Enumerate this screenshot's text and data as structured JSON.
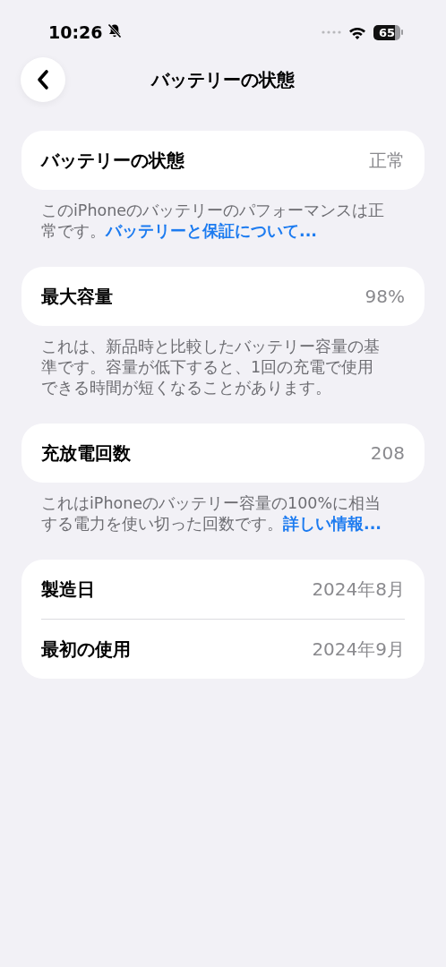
{
  "status_bar": {
    "time": "10:26",
    "silent": true,
    "battery": "65"
  },
  "nav": {
    "title": "バッテリーの状態"
  },
  "groups": [
    {
      "rows": [
        {
          "label": "バッテリーの状態",
          "value": "正常"
        }
      ],
      "footer": {
        "text": "このiPhoneのバッテリーのパフォーマンスは正常です。",
        "link": "バッテリーと保証について..."
      }
    },
    {
      "rows": [
        {
          "label": "最大容量",
          "value": "98%"
        }
      ],
      "footer": {
        "text": "これは、新品時と比較したバッテリー容量の基準です。容量が低下すると、1回の充電で使用できる時間が短くなることがあります。"
      }
    },
    {
      "rows": [
        {
          "label": "充放電回数",
          "value": "208"
        }
      ],
      "footer": {
        "text": "これはiPhoneのバッテリー容量の100%に相当する電力を使い切った回数です。",
        "link": "詳しい情報..."
      }
    },
    {
      "rows": [
        {
          "label": "製造日",
          "value": "2024年8月"
        },
        {
          "label": "最初の使用",
          "value": "2024年9月"
        }
      ]
    }
  ]
}
